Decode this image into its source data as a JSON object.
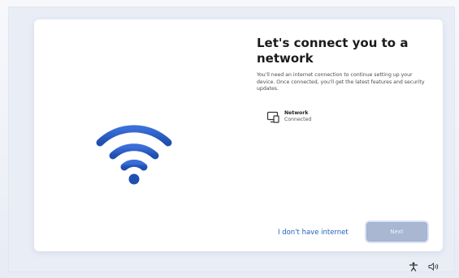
{
  "title": "Let's connect you to a network",
  "description": "You'll need an internet connection to continue setting up your device. Once connected, you'll get the latest features and security updates.",
  "network": {
    "name": "Network",
    "status": "Connected",
    "icon": "network-ethernet-icon"
  },
  "actions": {
    "no_internet_label": "I don't have internet",
    "next_label": "Next"
  },
  "illustration_icon": "wifi-icon",
  "tray_icons": [
    "accessibility-icon",
    "volume-icon"
  ],
  "colors": {
    "accent": "#2b5cc7",
    "link": "#1f5fbf",
    "next_disabled": "#aab7d3",
    "card": "#ffffff"
  }
}
